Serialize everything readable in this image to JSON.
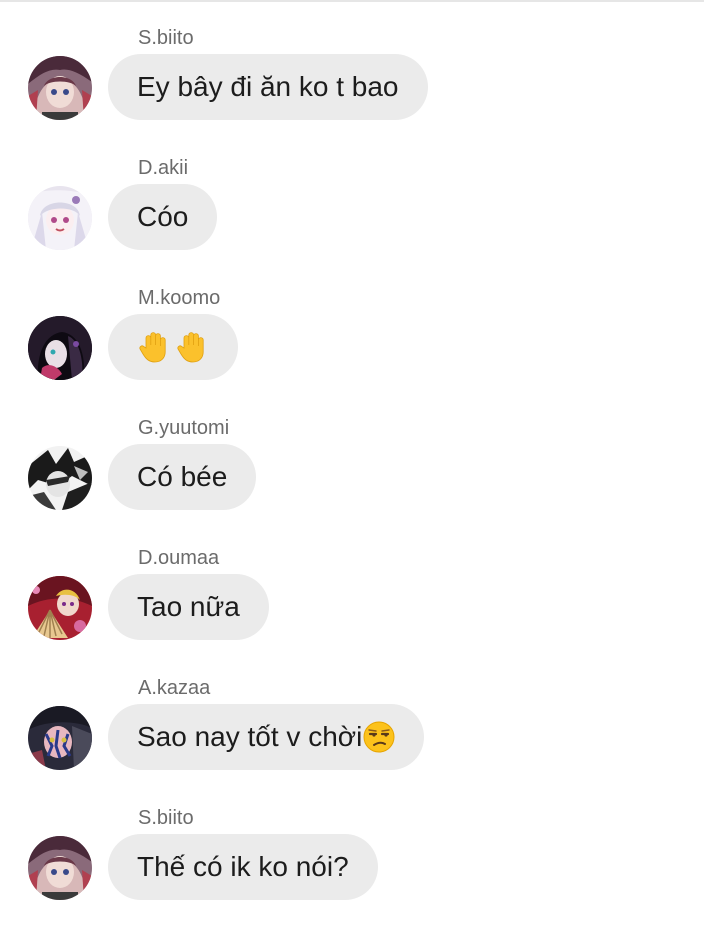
{
  "messages": [
    {
      "sender": "S.biito",
      "text": "Ey bây đi ăn ko t bao",
      "avatar": "avatar-pink-hair-girl"
    },
    {
      "sender": "D.akii",
      "text": "Cóo",
      "avatar": "avatar-white-hair-girl"
    },
    {
      "sender": "M.koomo",
      "text": "",
      "emoji": [
        "raised-hand-emoji",
        "raised-hand-emoji"
      ],
      "avatar": "avatar-dark-hair-girl"
    },
    {
      "sender": "G.yuutomi",
      "text": "Có bée",
      "avatar": "avatar-monochrome-boy"
    },
    {
      "sender": "D.oumaa",
      "text": "Tao nữa",
      "avatar": "avatar-fan-character"
    },
    {
      "sender": "A.kazaa",
      "text": "Sao nay tốt v chời",
      "emoji": [
        "unamused-face-emoji"
      ],
      "avatar": "avatar-tattooed-character"
    },
    {
      "sender": "S.biito",
      "text": "Thế có ik ko nói?",
      "avatar": "avatar-pink-hair-girl"
    }
  ],
  "colors": {
    "bubble": "#ebebeb",
    "sender": "#6b6b6b",
    "text": "#1c1c1c",
    "background": "#ffffff"
  }
}
